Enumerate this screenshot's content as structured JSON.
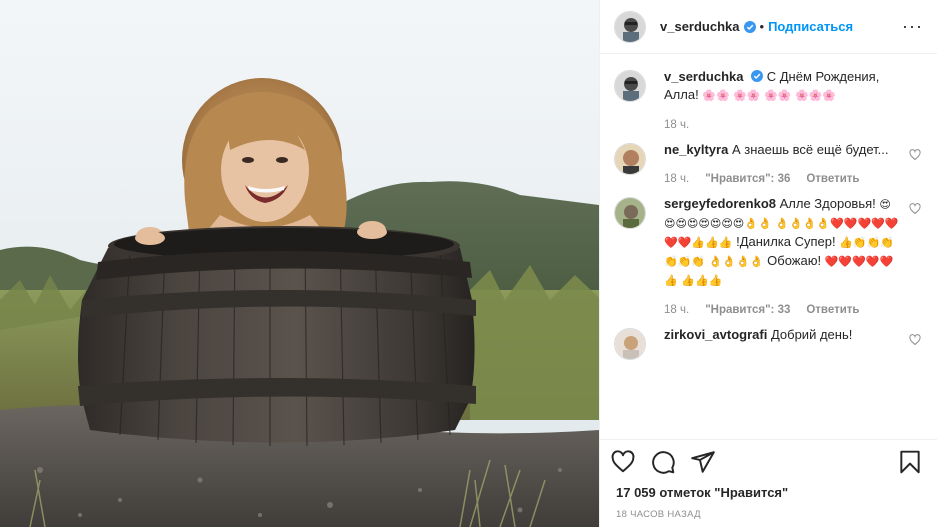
{
  "post": {
    "username": "v_serduchka",
    "follow_label": "Подписаться",
    "dot": "•",
    "more_label": "···",
    "likes_text": "17 059 отметок \"Нравится\"",
    "time_text": "18 часов назад"
  },
  "caption": {
    "username": "v_serduchka",
    "text": "С Днём Рождения, Алла!",
    "emoji_text": "🌸🌸 🌸🌸 🌸🌸 🌸🌸🌸",
    "time": "18 ч."
  },
  "comments": [
    {
      "username": "ne_kyltyra",
      "text": "А знаешь всё ещё будет...",
      "time": "18 ч.",
      "likes": "\"Нравится\": 36",
      "reply": "Ответить"
    },
    {
      "username": "sergeyfedorenko8",
      "text_1": "Алле Здоровья!",
      "emoji_1": "😍😍😍😍😍😍😍😍👌👌",
      "emoji_2": "👌👌👌👌❤️❤️❤️❤️❤️❤️❤️👍👍👍",
      "text_2": "!Данилка Супер!",
      "emoji_3": "👍👏👏👏👏👏👏",
      "emoji_4": "👌👌👌👌",
      "text_3": "Обожаю!",
      "emoji_5": "❤️❤️❤️❤️❤️👍",
      "emoji_6": "👍👍👍",
      "time": "18 ч.",
      "likes": "\"Нравится\": 33",
      "reply": "Ответить"
    },
    {
      "username": "zirkovi_avtografi",
      "text": "Добрий день!"
    }
  ],
  "colors": {
    "accent": "#0095f6",
    "verified": "#3897f0",
    "muted": "#8e8e8e",
    "heart_red": "#c0262c"
  },
  "icons": [
    "heart-icon",
    "comment-icon",
    "share-icon",
    "bookmark-icon",
    "verified-badge-icon",
    "more-options-icon"
  ]
}
